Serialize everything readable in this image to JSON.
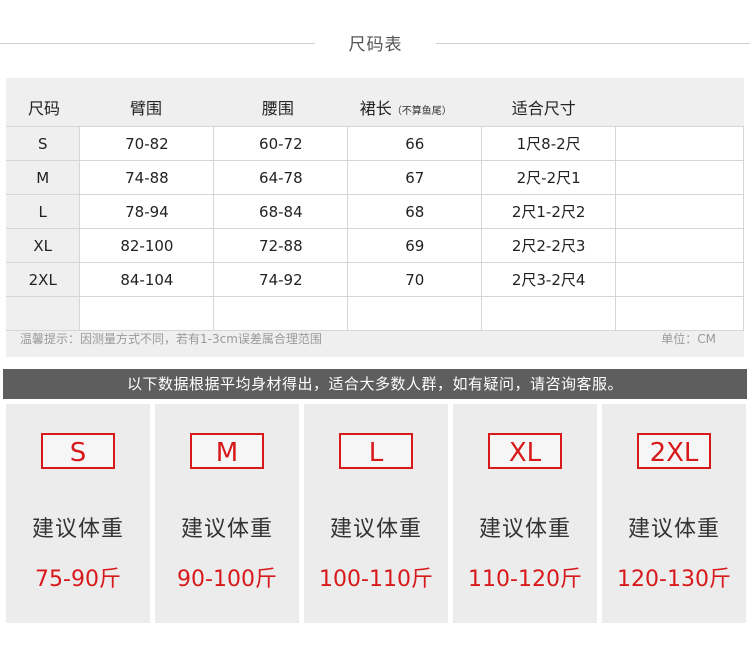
{
  "header": {
    "title": "尺码表"
  },
  "table": {
    "columns": [
      "尺码",
      "臂围",
      "腰围",
      "裙长",
      "适合尺寸"
    ],
    "column_note": "（不算鱼尾）",
    "rows": [
      {
        "size": "S",
        "arm": "70-82",
        "waist": "60-72",
        "length": "66",
        "fit": "1尺8-2尺"
      },
      {
        "size": "M",
        "arm": "74-88",
        "waist": "64-78",
        "length": "67",
        "fit": "2尺-2尺1"
      },
      {
        "size": "L",
        "arm": "78-94",
        "waist": "68-84",
        "length": "68",
        "fit": "2尺1-2尺2"
      },
      {
        "size": "XL",
        "arm": "82-100",
        "waist": "72-88",
        "length": "69",
        "fit": "2尺2-2尺3"
      },
      {
        "size": "2XL",
        "arm": "84-104",
        "waist": "74-92",
        "length": "70",
        "fit": "2尺3-2尺4"
      }
    ],
    "note": "温馨提示：因测量方式不同，若有1-3cm误差属合理范围",
    "unit": "单位：CM"
  },
  "banner": {
    "text": "以下数据根据平均身材得出，适合大多数人群，如有疑问，请咨询客服。"
  },
  "cards": [
    {
      "size": "S",
      "label": "建议体重",
      "weight": "75-90斤"
    },
    {
      "size": "M",
      "label": "建议体重",
      "weight": "90-100斤"
    },
    {
      "size": "L",
      "label": "建议体重",
      "weight": "100-110斤"
    },
    {
      "size": "XL",
      "label": "建议体重",
      "weight": "110-120斤"
    },
    {
      "size": "2XL",
      "label": "建议体重",
      "weight": "120-130斤"
    }
  ],
  "colors": {
    "accent": "#d8191c",
    "banner_bg": "#5e5e5e",
    "panel_bg": "#efefef"
  }
}
